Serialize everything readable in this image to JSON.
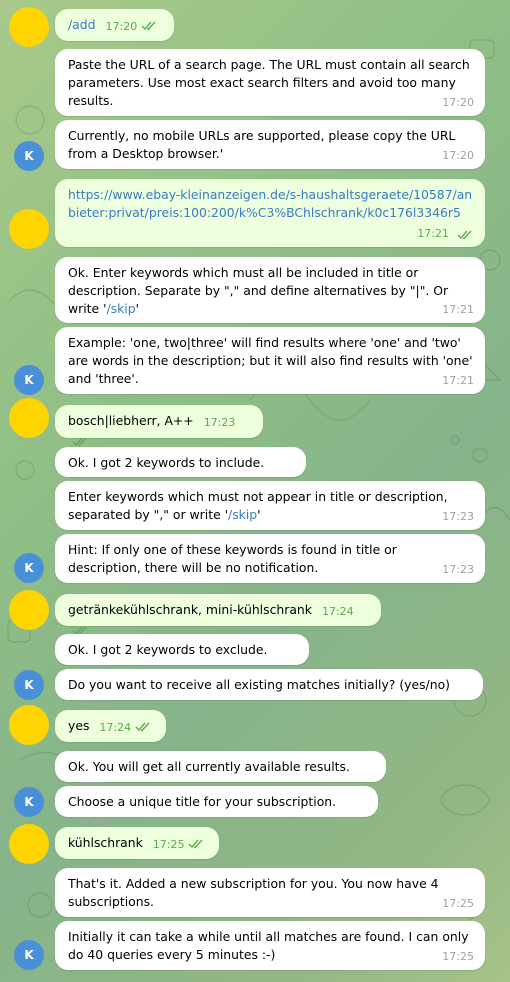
{
  "bot_avatar_letter": "K",
  "messages": {
    "m1": {
      "text": "/add",
      "time": "17:20"
    },
    "m2": {
      "text": "Paste the URL of a search page. The URL must contain all search parameters. Use most exact search filters and avoid too many results.",
      "time": "17:20"
    },
    "m3": {
      "text": "Currently, no mobile URLs are supported, please copy the URL from a Desktop browser.'",
      "time": "17:20"
    },
    "m4": {
      "text": "https://www.ebay-kleinanzeigen.de/s-haushaltsgeraete/10587/anbieter:privat/preis:100:200/k%C3%BChlschrank/k0c176l3346r5",
      "time": "17:21"
    },
    "m5": {
      "text_a": "Ok. Enter keywords which must all be included in title or description. Separate by \",\" and define alternatives by \"|\". Or write '",
      "link": "/skip",
      "text_b": "'",
      "time": "17:21"
    },
    "m6": {
      "text": "Example: 'one, two|three' will find results where 'one' and 'two' are words in the description; but it will also find results with 'one' and 'three'.",
      "time": "17:21"
    },
    "m7": {
      "text": "bosch|liebherr, A++",
      "time": "17:23"
    },
    "m8": {
      "text": "Ok. I got 2 keywords to include.",
      "time": "17:23"
    },
    "m9": {
      "text_a": "Enter keywords which must not appear in title or description, separated by \",\" or write '",
      "link": "/skip",
      "text_b": "'",
      "time": "17:23"
    },
    "m10": {
      "text": "Hint: If only one of these keywords is found in title or description, there will be no notification.",
      "time": "17:23"
    },
    "m11": {
      "text": "getränkekühlschrank, mini-kühlschrank",
      "time": "17:24"
    },
    "m12": {
      "text": "Ok. I got 2 keywords to exclude.",
      "time": "17:24"
    },
    "m13": {
      "text": "Do you want to receive all existing matches initially? (yes/no)",
      "time": "17:24"
    },
    "m14": {
      "text": "yes",
      "time": "17:24"
    },
    "m15": {
      "text": "Ok. You will get all currently available results.",
      "time": "17:24"
    },
    "m16": {
      "text": "Choose a unique title for your subscription.",
      "time": "17:24"
    },
    "m17": {
      "text": "kühlschrank",
      "time": "17:25"
    },
    "m18": {
      "text": "That's it. Added a new subscription for you. You now have 4 subscriptions.",
      "time": "17:25"
    },
    "m19": {
      "text": "Initially it can take a while until all matches are found. I can only do 40 queries every 5 minutes :-)",
      "time": "17:25"
    }
  }
}
